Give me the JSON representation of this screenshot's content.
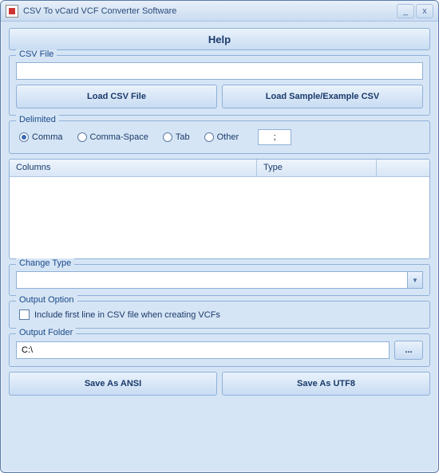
{
  "window": {
    "title": "CSV To vCard VCF Converter Software"
  },
  "help_button": "Help",
  "csv_file": {
    "legend": "CSV File",
    "path": "",
    "load_button": "Load CSV File",
    "sample_button": "Load Sample/Example CSV"
  },
  "delimited": {
    "legend": "Delimited",
    "options": {
      "comma": "Comma",
      "comma_space": "Comma-Space",
      "tab": "Tab",
      "other": "Other"
    },
    "selected": "comma",
    "other_value": ";"
  },
  "columns_table": {
    "headers": {
      "columns": "Columns",
      "type": "Type"
    },
    "rows": []
  },
  "change_type": {
    "legend": "Change Type",
    "value": ""
  },
  "output_option": {
    "legend": "Output Option",
    "include_first_line": "Include first line in CSV file when creating VCFs",
    "checked": false
  },
  "output_folder": {
    "legend": "Output Folder",
    "path": "C:\\",
    "browse": "..."
  },
  "save": {
    "ansi": "Save As ANSI",
    "utf8": "Save As UTF8"
  }
}
